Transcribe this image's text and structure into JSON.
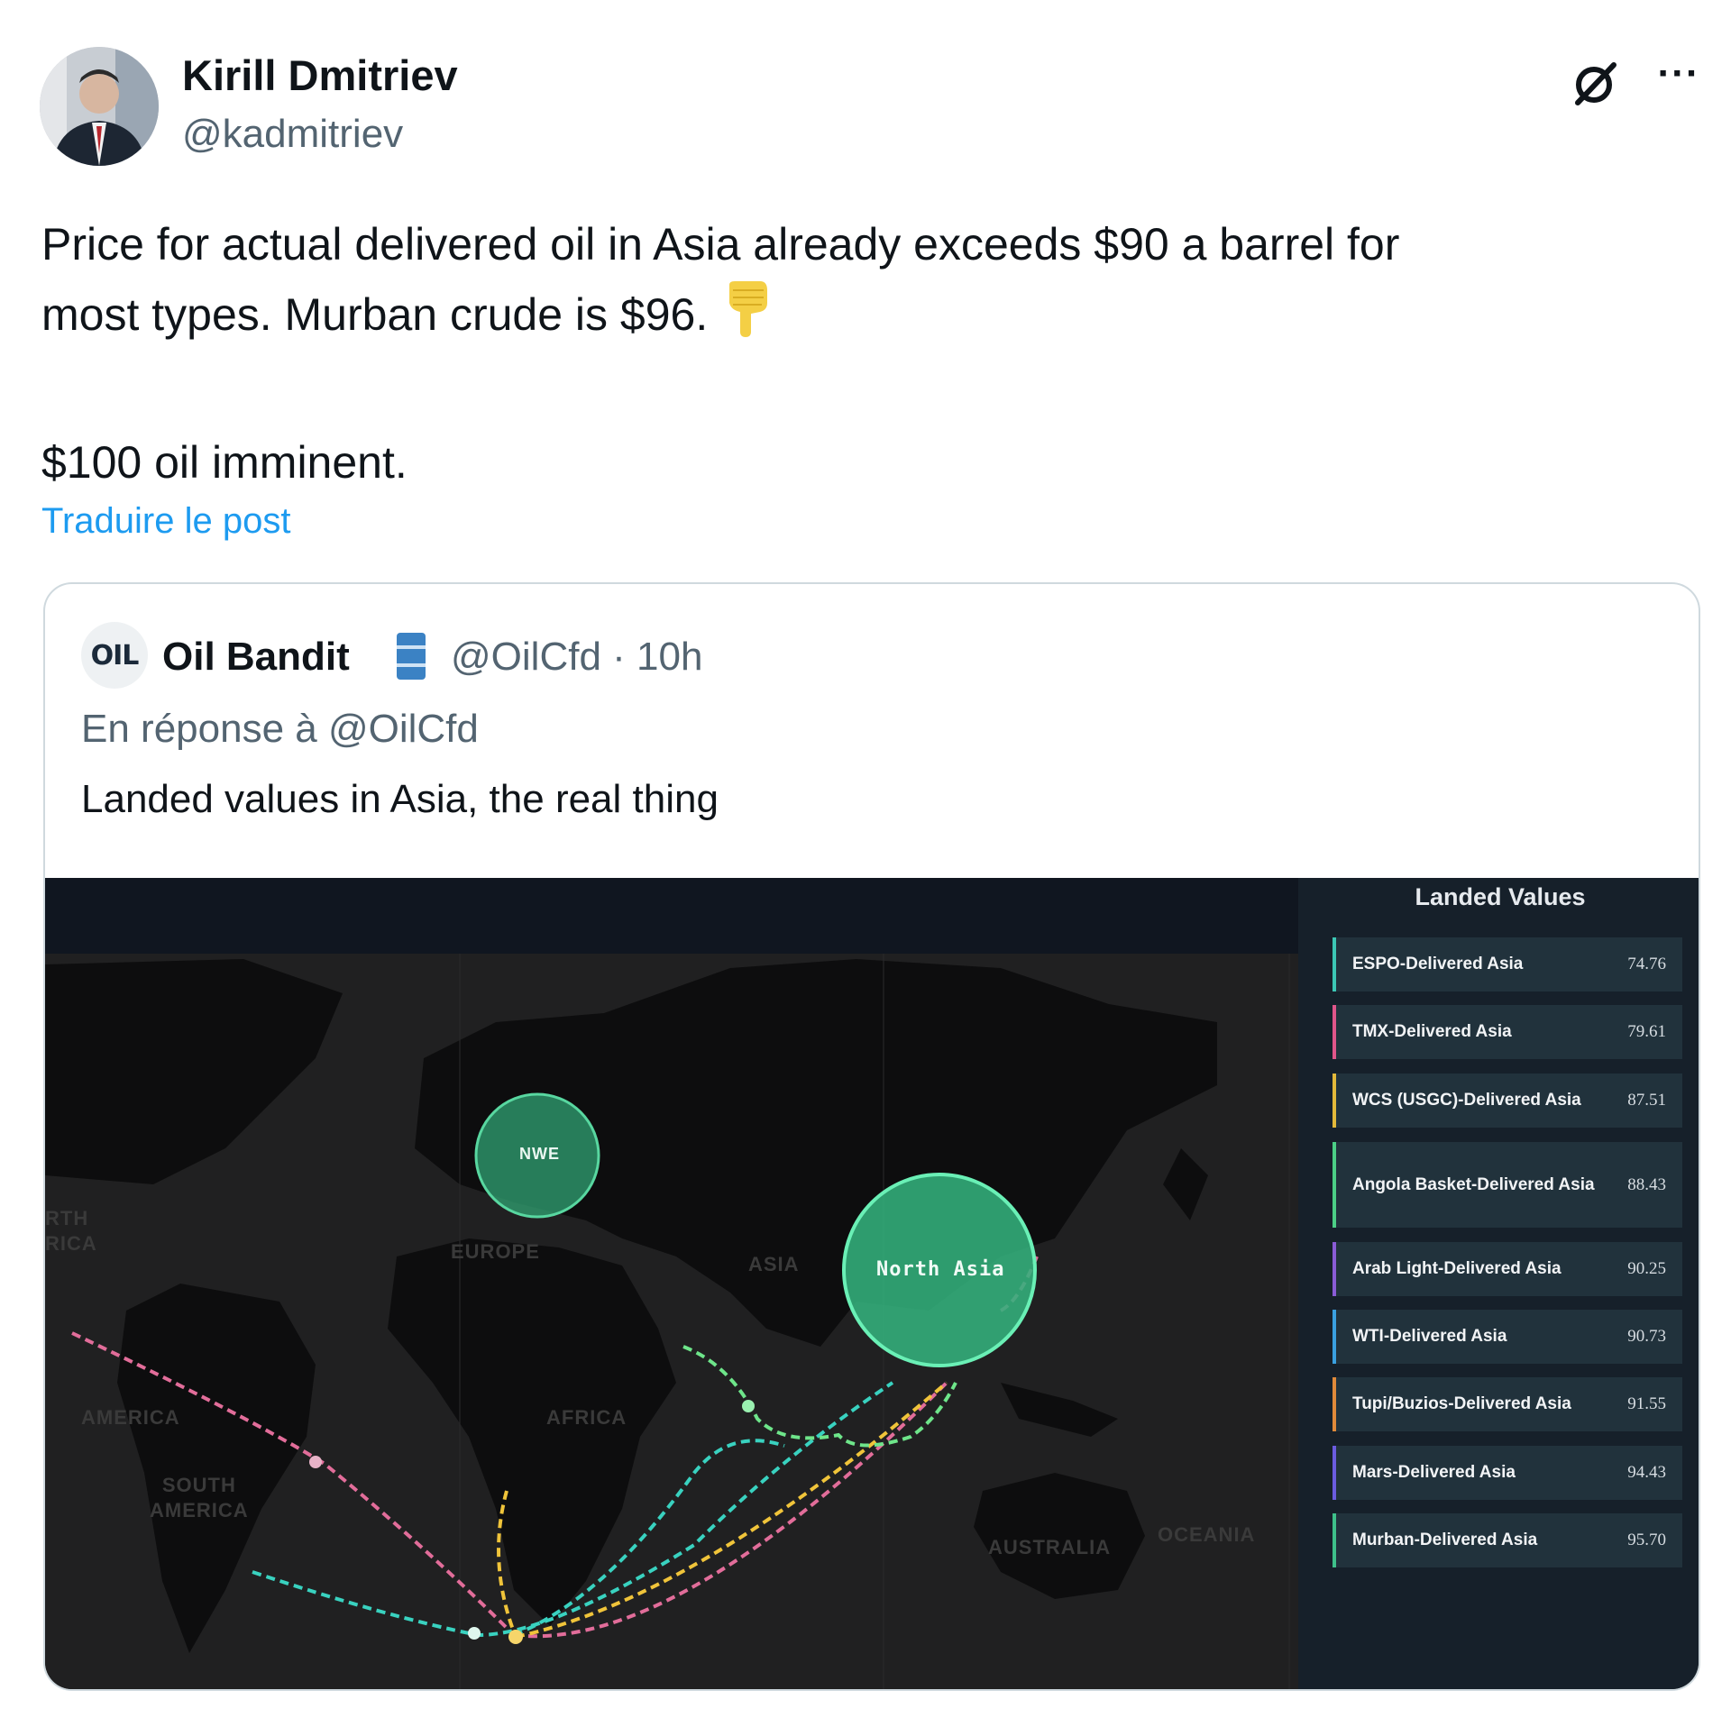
{
  "author": {
    "name": "Kirill Dmitriev",
    "handle": "@kadmitriev"
  },
  "tweet": {
    "line1": "Price for actual delivered oil in Asia already exceeds $90 a barrel for",
    "line2": "most types. Murban crude is $96.",
    "line3": "$100 oil imminent.",
    "emoji_icon": "pointing-down-emoji",
    "translate": "Traduire le post"
  },
  "icons": {
    "grok": "grok-icon",
    "more": "more-options-icon",
    "more_glyph": "···"
  },
  "quote": {
    "logo": "OIL",
    "name": "Oil Bandit",
    "badge_icon": "oil-barrel-icon",
    "handle_time": "@OilCfd · 10h",
    "reply_to": "En réponse à @OilCfd",
    "text": "Landed values in Asia, the real thing"
  },
  "map": {
    "labels": {
      "nwe": "NWE",
      "north_asia": "North Asia",
      "europe": "EUROPE",
      "asia": "ASIA",
      "africa": "AFRICA",
      "south_america": "SOUTH\nAMERICA",
      "america": "AMERICA",
      "north_america": "RTH\nRICA",
      "australia": "AUSTRALIA",
      "oceania": "OCEANIA"
    },
    "colors": {
      "bubble": "#2fa070",
      "route_pink": "#e26d9a",
      "route_teal": "#39d2c0",
      "route_yellow": "#f0c43a",
      "route_green": "#6ee58a"
    }
  },
  "landed_values": {
    "title": "Landed Values",
    "items": [
      {
        "name": "ESPO-Delivered Asia",
        "value": "74.76",
        "color": "#3cc7b5"
      },
      {
        "name": "TMX-Delivered Asia",
        "value": "79.61",
        "color": "#e0568a"
      },
      {
        "name": "WCS (USGC)-Delivered Asia",
        "value": "87.51",
        "color": "#e3b93a"
      },
      {
        "name": "Angola Basket-Delivered Asia",
        "value": "88.43",
        "color": "#4ccf86"
      },
      {
        "name": "Arab Light-Delivered Asia",
        "value": "90.25",
        "color": "#8a5cd6"
      },
      {
        "name": "WTI-Delivered Asia",
        "value": "90.73",
        "color": "#3aa0e0"
      },
      {
        "name": "Tupi/Buzios-Delivered Asia",
        "value": "91.55",
        "color": "#e08a3a"
      },
      {
        "name": "Mars-Delivered Asia",
        "value": "94.43",
        "color": "#6b5ce0"
      },
      {
        "name": "Murban-Delivered Asia",
        "value": "95.70",
        "color": "#3ec08a"
      }
    ]
  }
}
